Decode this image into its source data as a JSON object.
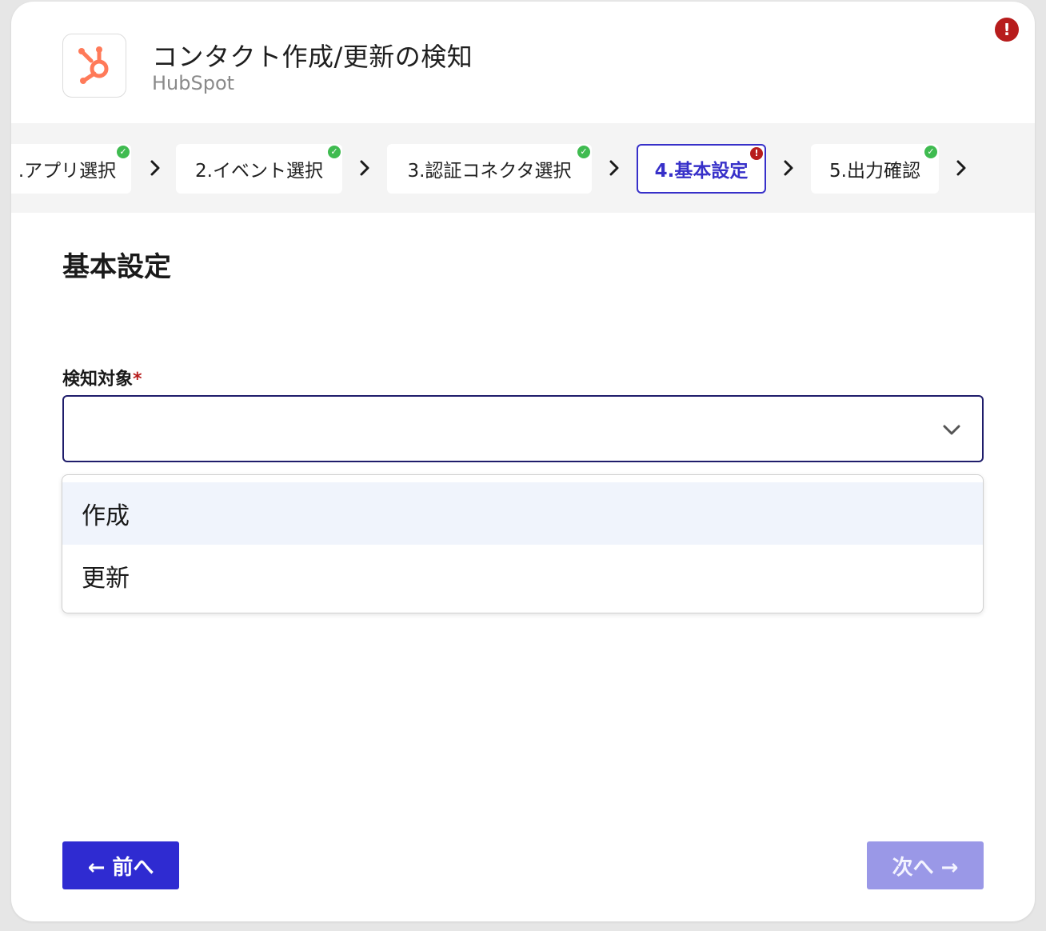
{
  "header": {
    "title": "コンタクト作成/更新の検知",
    "subtitle": "HubSpot",
    "app_icon": "hubspot-sprocket-icon",
    "brand_color": "#ff7a59",
    "error_badge": "!"
  },
  "stepper": {
    "steps": [
      {
        "label": ".アプリ選択",
        "status": "complete",
        "status_glyph": "✓"
      },
      {
        "label": "2.イベント選択",
        "status": "complete",
        "status_glyph": "✓"
      },
      {
        "label": "3.認証コネクタ選択",
        "status": "complete",
        "status_glyph": "✓"
      },
      {
        "label": "4.基本設定",
        "status": "error",
        "status_glyph": "!",
        "active": true
      },
      {
        "label": "5.出力確認",
        "status": "complete",
        "status_glyph": "✓"
      }
    ],
    "separator_icon": "chevron-right-icon",
    "accent_color": "#3730c9",
    "ok_color": "#3fbb50",
    "error_color": "#b71c1c"
  },
  "main": {
    "section_title": "基本設定",
    "field": {
      "label": "検知対象",
      "required_mark": "*",
      "value": ""
    },
    "dropdown": {
      "options": [
        "作成",
        "更新"
      ],
      "highlighted_index": 0
    }
  },
  "footer": {
    "prev_label": "← 前へ",
    "next_label": "次へ →",
    "prev_color": "#2f2bd1",
    "next_color": "#9a98e7",
    "next_disabled": true
  }
}
